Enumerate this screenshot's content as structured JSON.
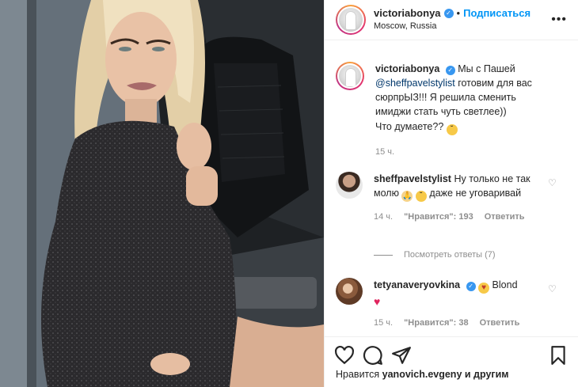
{
  "post": {
    "username": "victoriabonya",
    "separator": "•",
    "follow_label": "Подписаться",
    "location": "Moscow, Russia",
    "more_label": "•••"
  },
  "caption": {
    "username": "victoriabonya",
    "text_before_mention": "Мы с Пашей",
    "mention": "@sheffpavelstylist",
    "text_after_mention": "готовим для вас сюрпрЫЗ!!! Я решила сменить имиджи стать чуть светлее))",
    "question": "Что думаете??",
    "time": "15 ч."
  },
  "comments": [
    {
      "username": "sheffpavelstylist",
      "text_part1": "Ну только не так молю",
      "text_part2": "даже не уговаривай",
      "time": "14 ч.",
      "likes": "\"Нравится\": 193",
      "reply_label": "Ответить",
      "view_replies": "Посмотреть ответы (7)"
    },
    {
      "username": "tetyanaveryovkina",
      "text": "Blond",
      "time": "15 ч.",
      "likes": "\"Нравится\": 38",
      "reply_label": "Ответить"
    }
  ],
  "footer": {
    "likes_prefix": "Нравится",
    "likes_user": "yanovich.evgeny",
    "likes_suffix": "и другим"
  },
  "colors": {
    "follow": "#0095f6",
    "verified": "#3897f0",
    "muted": "#8e8e8e",
    "text": "#262626"
  }
}
